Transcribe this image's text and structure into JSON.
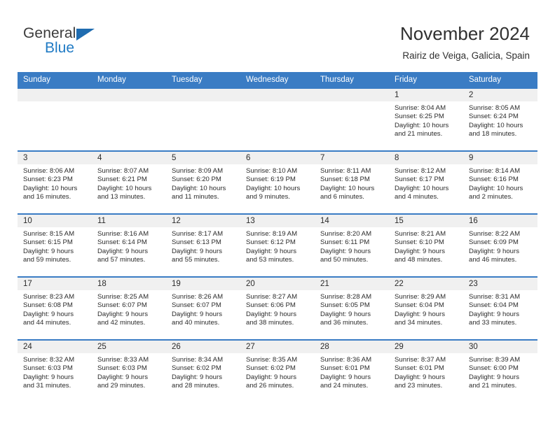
{
  "brand": {
    "word_one": "General",
    "word_two": "Blue",
    "triangle_color": "#1f6cb0",
    "blue_color": "#1f7ac4"
  },
  "header": {
    "title": "November 2024",
    "subtitle": "Rairiz de Veiga, Galicia, Spain"
  },
  "theme": {
    "header_blue": "#3a7cc4",
    "daynum_band": "#f0f0f0",
    "cell_bg": "#ffffff",
    "text": "#2b2b2b"
  },
  "weekday_headers": [
    "Sunday",
    "Monday",
    "Tuesday",
    "Wednesday",
    "Thursday",
    "Friday",
    "Saturday"
  ],
  "weeks": [
    [
      {
        "day": "",
        "blank": true
      },
      {
        "day": "",
        "blank": true
      },
      {
        "day": "",
        "blank": true
      },
      {
        "day": "",
        "blank": true
      },
      {
        "day": "",
        "blank": true
      },
      {
        "day": "1",
        "sunrise": "Sunrise: 8:04 AM",
        "sunset": "Sunset: 6:25 PM",
        "daylight_1": "Daylight: 10 hours",
        "daylight_2": "and 21 minutes."
      },
      {
        "day": "2",
        "sunrise": "Sunrise: 8:05 AM",
        "sunset": "Sunset: 6:24 PM",
        "daylight_1": "Daylight: 10 hours",
        "daylight_2": "and 18 minutes."
      }
    ],
    [
      {
        "day": "3",
        "sunrise": "Sunrise: 8:06 AM",
        "sunset": "Sunset: 6:23 PM",
        "daylight_1": "Daylight: 10 hours",
        "daylight_2": "and 16 minutes."
      },
      {
        "day": "4",
        "sunrise": "Sunrise: 8:07 AM",
        "sunset": "Sunset: 6:21 PM",
        "daylight_1": "Daylight: 10 hours",
        "daylight_2": "and 13 minutes."
      },
      {
        "day": "5",
        "sunrise": "Sunrise: 8:09 AM",
        "sunset": "Sunset: 6:20 PM",
        "daylight_1": "Daylight: 10 hours",
        "daylight_2": "and 11 minutes."
      },
      {
        "day": "6",
        "sunrise": "Sunrise: 8:10 AM",
        "sunset": "Sunset: 6:19 PM",
        "daylight_1": "Daylight: 10 hours",
        "daylight_2": "and 9 minutes."
      },
      {
        "day": "7",
        "sunrise": "Sunrise: 8:11 AM",
        "sunset": "Sunset: 6:18 PM",
        "daylight_1": "Daylight: 10 hours",
        "daylight_2": "and 6 minutes."
      },
      {
        "day": "8",
        "sunrise": "Sunrise: 8:12 AM",
        "sunset": "Sunset: 6:17 PM",
        "daylight_1": "Daylight: 10 hours",
        "daylight_2": "and 4 minutes."
      },
      {
        "day": "9",
        "sunrise": "Sunrise: 8:14 AM",
        "sunset": "Sunset: 6:16 PM",
        "daylight_1": "Daylight: 10 hours",
        "daylight_2": "and 2 minutes."
      }
    ],
    [
      {
        "day": "10",
        "sunrise": "Sunrise: 8:15 AM",
        "sunset": "Sunset: 6:15 PM",
        "daylight_1": "Daylight: 9 hours",
        "daylight_2": "and 59 minutes."
      },
      {
        "day": "11",
        "sunrise": "Sunrise: 8:16 AM",
        "sunset": "Sunset: 6:14 PM",
        "daylight_1": "Daylight: 9 hours",
        "daylight_2": "and 57 minutes."
      },
      {
        "day": "12",
        "sunrise": "Sunrise: 8:17 AM",
        "sunset": "Sunset: 6:13 PM",
        "daylight_1": "Daylight: 9 hours",
        "daylight_2": "and 55 minutes."
      },
      {
        "day": "13",
        "sunrise": "Sunrise: 8:19 AM",
        "sunset": "Sunset: 6:12 PM",
        "daylight_1": "Daylight: 9 hours",
        "daylight_2": "and 53 minutes."
      },
      {
        "day": "14",
        "sunrise": "Sunrise: 8:20 AM",
        "sunset": "Sunset: 6:11 PM",
        "daylight_1": "Daylight: 9 hours",
        "daylight_2": "and 50 minutes."
      },
      {
        "day": "15",
        "sunrise": "Sunrise: 8:21 AM",
        "sunset": "Sunset: 6:10 PM",
        "daylight_1": "Daylight: 9 hours",
        "daylight_2": "and 48 minutes."
      },
      {
        "day": "16",
        "sunrise": "Sunrise: 8:22 AM",
        "sunset": "Sunset: 6:09 PM",
        "daylight_1": "Daylight: 9 hours",
        "daylight_2": "and 46 minutes."
      }
    ],
    [
      {
        "day": "17",
        "sunrise": "Sunrise: 8:23 AM",
        "sunset": "Sunset: 6:08 PM",
        "daylight_1": "Daylight: 9 hours",
        "daylight_2": "and 44 minutes."
      },
      {
        "day": "18",
        "sunrise": "Sunrise: 8:25 AM",
        "sunset": "Sunset: 6:07 PM",
        "daylight_1": "Daylight: 9 hours",
        "daylight_2": "and 42 minutes."
      },
      {
        "day": "19",
        "sunrise": "Sunrise: 8:26 AM",
        "sunset": "Sunset: 6:07 PM",
        "daylight_1": "Daylight: 9 hours",
        "daylight_2": "and 40 minutes."
      },
      {
        "day": "20",
        "sunrise": "Sunrise: 8:27 AM",
        "sunset": "Sunset: 6:06 PM",
        "daylight_1": "Daylight: 9 hours",
        "daylight_2": "and 38 minutes."
      },
      {
        "day": "21",
        "sunrise": "Sunrise: 8:28 AM",
        "sunset": "Sunset: 6:05 PM",
        "daylight_1": "Daylight: 9 hours",
        "daylight_2": "and 36 minutes."
      },
      {
        "day": "22",
        "sunrise": "Sunrise: 8:29 AM",
        "sunset": "Sunset: 6:04 PM",
        "daylight_1": "Daylight: 9 hours",
        "daylight_2": "and 34 minutes."
      },
      {
        "day": "23",
        "sunrise": "Sunrise: 8:31 AM",
        "sunset": "Sunset: 6:04 PM",
        "daylight_1": "Daylight: 9 hours",
        "daylight_2": "and 33 minutes."
      }
    ],
    [
      {
        "day": "24",
        "sunrise": "Sunrise: 8:32 AM",
        "sunset": "Sunset: 6:03 PM",
        "daylight_1": "Daylight: 9 hours",
        "daylight_2": "and 31 minutes."
      },
      {
        "day": "25",
        "sunrise": "Sunrise: 8:33 AM",
        "sunset": "Sunset: 6:03 PM",
        "daylight_1": "Daylight: 9 hours",
        "daylight_2": "and 29 minutes."
      },
      {
        "day": "26",
        "sunrise": "Sunrise: 8:34 AM",
        "sunset": "Sunset: 6:02 PM",
        "daylight_1": "Daylight: 9 hours",
        "daylight_2": "and 28 minutes."
      },
      {
        "day": "27",
        "sunrise": "Sunrise: 8:35 AM",
        "sunset": "Sunset: 6:02 PM",
        "daylight_1": "Daylight: 9 hours",
        "daylight_2": "and 26 minutes."
      },
      {
        "day": "28",
        "sunrise": "Sunrise: 8:36 AM",
        "sunset": "Sunset: 6:01 PM",
        "daylight_1": "Daylight: 9 hours",
        "daylight_2": "and 24 minutes."
      },
      {
        "day": "29",
        "sunrise": "Sunrise: 8:37 AM",
        "sunset": "Sunset: 6:01 PM",
        "daylight_1": "Daylight: 9 hours",
        "daylight_2": "and 23 minutes."
      },
      {
        "day": "30",
        "sunrise": "Sunrise: 8:39 AM",
        "sunset": "Sunset: 6:00 PM",
        "daylight_1": "Daylight: 9 hours",
        "daylight_2": "and 21 minutes."
      }
    ]
  ]
}
